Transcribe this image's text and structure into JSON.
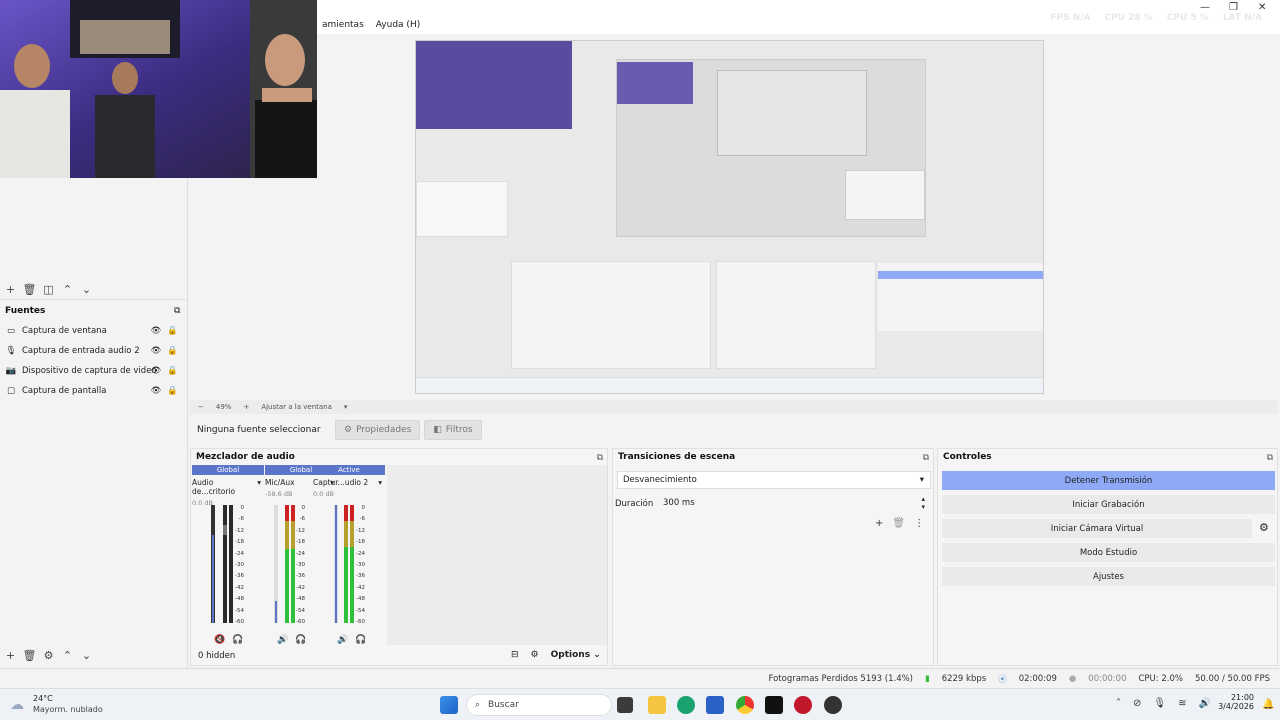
{
  "menu": {
    "items": [
      "amientas",
      "Ayuda (H)"
    ]
  },
  "top_stats": {
    "fps_label": "FPS",
    "fps_value": "N/A",
    "cpu_label": "CPU",
    "cpu_value": "28 %",
    "cpu2_label": "CPU",
    "cpu2_value": "5 %",
    "lat_label": "LAT",
    "lat_value": "N/A"
  },
  "sources": {
    "title": "Fuentes",
    "items": [
      {
        "label": "Captura de ventana",
        "icon": "window-icon"
      },
      {
        "label": "Captura de entrada audio 2",
        "icon": "microphone-icon"
      },
      {
        "label": "Dispositivo de captura de video",
        "icon": "camera-icon"
      },
      {
        "label": "Captura de pantalla",
        "icon": "monitor-icon"
      }
    ]
  },
  "zoombar": {
    "minus": "−",
    "zoom": "49%",
    "plus": "+",
    "fit": "Ajustar a la ventana"
  },
  "context": {
    "no_source": "Ninguna fuente seleccionar",
    "properties": "Propiedades",
    "filters": "Filtros"
  },
  "audio_mixer": {
    "title": "Mezclador de audio",
    "channels": [
      {
        "header": "Global",
        "name": "Audio de...critorio",
        "db": "0.0 dB"
      },
      {
        "header": "Global",
        "name": "Mic/Aux",
        "db": "-58.6 dB"
      },
      {
        "header": "Active",
        "name": "Captur...udio 2",
        "db": "0.0 dB"
      }
    ],
    "scale": [
      "0",
      "-6",
      "-12",
      "-18",
      "-24",
      "-30",
      "-36",
      "-42",
      "-48",
      "-54",
      "-60"
    ],
    "hidden": "0 hidden",
    "options": "Options"
  },
  "transitions": {
    "title": "Transiciones de escena",
    "selected": "Desvanecimiento",
    "duration_label": "Duración",
    "duration_value": "300 ms"
  },
  "controls": {
    "title": "Controles",
    "buttons": [
      "Detener Transmisión",
      "Iniciar Grabación",
      "Iniciar Cámara Virtual",
      "Modo Estudio",
      "Ajustes"
    ]
  },
  "status": {
    "dropped": "Fotogramas Perdidos 5193 (1.4%)",
    "bitrate": "6229 kbps",
    "stream_time": "02:00:09",
    "rec_time": "00:00:00",
    "cpu": "CPU: 2.0%",
    "fps": "50.00 / 50.00 FPS"
  },
  "taskbar": {
    "weather_temp": "24°C",
    "weather_desc": "Mayorm. nublado",
    "search": "Buscar",
    "time": "21:00",
    "date": "3/4/2026"
  },
  "colors": {
    "accent": "#8ea9f5",
    "channel_header": "#5b76c9",
    "meter_green": "#2fbf3a",
    "meter_red": "#d22"
  }
}
